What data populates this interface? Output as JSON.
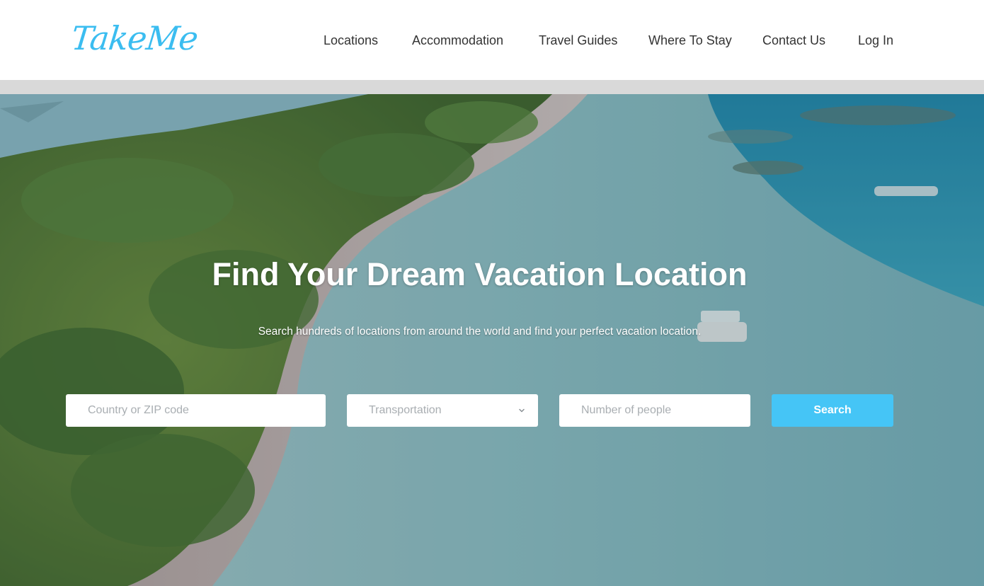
{
  "brand": {
    "name": "TakeMe",
    "color": "#3bbdf0"
  },
  "nav": {
    "items": [
      {
        "label": "Locations"
      },
      {
        "label": "Accommodation"
      },
      {
        "label": "Travel Guides"
      },
      {
        "label": "Where To Stay"
      },
      {
        "label": "Contact Us"
      },
      {
        "label": "Log In"
      }
    ]
  },
  "hero": {
    "title": "Find Your Dream Vacation Location",
    "subtitle": "Search hundreds of locations from around the world and find your perfect vacation location.",
    "background": "aerial-beach-island-photo"
  },
  "search": {
    "country_placeholder": "Country or ZIP code",
    "transport_selected": "Transportation",
    "people_placeholder": "Number of people",
    "button_label": "Search",
    "button_color": "#45c5f6"
  }
}
